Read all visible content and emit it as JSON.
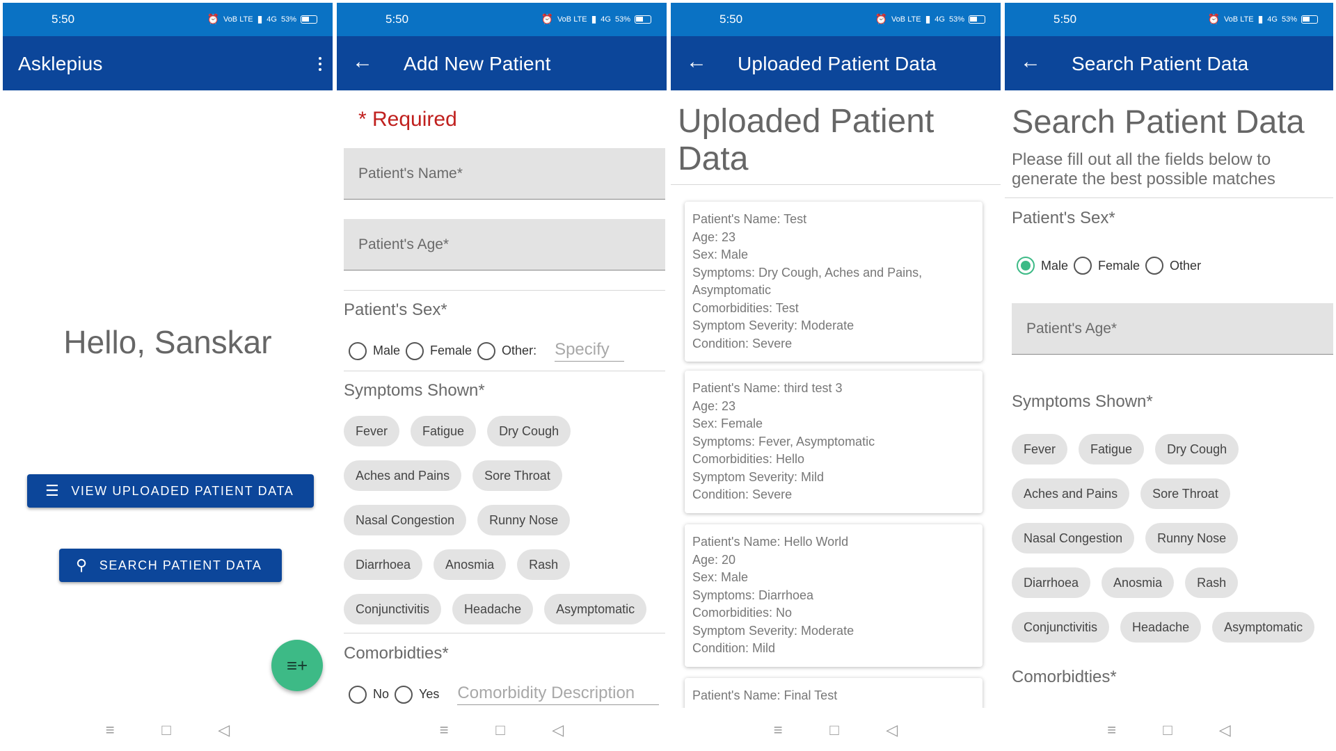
{
  "status": {
    "time": "5:50",
    "battery": "53%",
    "net1": "VoB LTE",
    "net2": "4G",
    "alarm_icon": "alarm-icon",
    "signal_icon": "signal-icon"
  },
  "nav": {
    "menu_icon": "≡",
    "home_icon": "□",
    "back_icon": "◁"
  },
  "home": {
    "app_title": "Asklepius",
    "greeting": "Hello, Sanskar",
    "view_button": "VIEW UPLOADED PATIENT DATA",
    "search_button": "SEARCH PATIENT DATA",
    "fab_icon": "playlist-add-icon"
  },
  "add": {
    "app_title": "Add New Patient",
    "required": "* Required",
    "name_placeholder": "Patient's Name*",
    "age_placeholder": "Patient's Age*",
    "sex_title": "Patient's Sex*",
    "sex_options": [
      "Male",
      "Female",
      "Other:"
    ],
    "specify_placeholder": "Specify",
    "symptoms_title": "Symptoms Shown*",
    "symptom_rows": [
      [
        "Fever",
        "Fatigue",
        "Dry Cough"
      ],
      [
        "Aches and Pains",
        "Sore Throat"
      ],
      [
        "Nasal Congestion",
        "Runny Nose"
      ],
      [
        "Diarrhoea",
        "Anosmia",
        "Rash"
      ],
      [
        "Conjunctivitis",
        "Headache",
        "Asymptomatic"
      ]
    ],
    "comorbidities_title": "Comorbidties*",
    "comorbidity_options": [
      "No",
      "Yes"
    ],
    "comorbidity_placeholder": "Comorbidity Description"
  },
  "uploaded": {
    "app_title": "Uploaded Patient Data",
    "heading_line1": "Uploaded Patient",
    "heading_line2": "Data",
    "records": [
      {
        "name": "Patient's Name: Test",
        "age": "Age: 23",
        "sex": "Sex: Male",
        "symptoms": "Symptoms: Dry Cough, Aches and Pains, Asymptomatic",
        "comorbidities": "Comorbidities: Test",
        "severity": "Symptom Severity: Moderate",
        "condition": "Condition: Severe"
      },
      {
        "name": "Patient's Name: third test 3",
        "age": "Age: 23",
        "sex": "Sex: Female",
        "symptoms": "Symptoms: Fever, Asymptomatic",
        "comorbidities": "Comorbidities: Hello",
        "severity": "Symptom Severity: Mild",
        "condition": "Condition: Severe"
      },
      {
        "name": "Patient's Name: Hello World",
        "age": "Age: 20",
        "sex": "Sex: Male",
        "symptoms": "Symptoms: Diarrhoea",
        "comorbidities": "Comorbidities: No",
        "severity": "Symptom Severity: Moderate",
        "condition": "Condition: Mild"
      },
      {
        "name": "Patient's Name: Final Test"
      }
    ]
  },
  "search": {
    "app_title": "Search Patient Data",
    "heading": "Search Patient Data",
    "intro": "Please fill out all the fields below to generate the best possible matches",
    "sex_title": "Patient's Sex*",
    "sex_options": [
      "Male",
      "Female",
      "Other"
    ],
    "sex_selected": "Male",
    "age_placeholder": "Patient's Age*",
    "symptoms_title": "Symptoms Shown*",
    "symptom_rows": [
      [
        "Fever",
        "Fatigue",
        "Dry Cough"
      ],
      [
        "Aches and Pains",
        "Sore Throat"
      ],
      [
        "Nasal Congestion",
        "Runny Nose"
      ],
      [
        "Diarrhoea",
        "Anosmia",
        "Rash"
      ],
      [
        "Conjunctivitis",
        "Headache",
        "Asymptomatic"
      ]
    ],
    "comorbidities_title": "Comorbidties*"
  },
  "colors": {
    "status_bar": "#0a72c4",
    "app_bar": "#0c469a",
    "fab": "#3dba86",
    "required": "#c0201e",
    "chip": "#e3e3e3"
  }
}
